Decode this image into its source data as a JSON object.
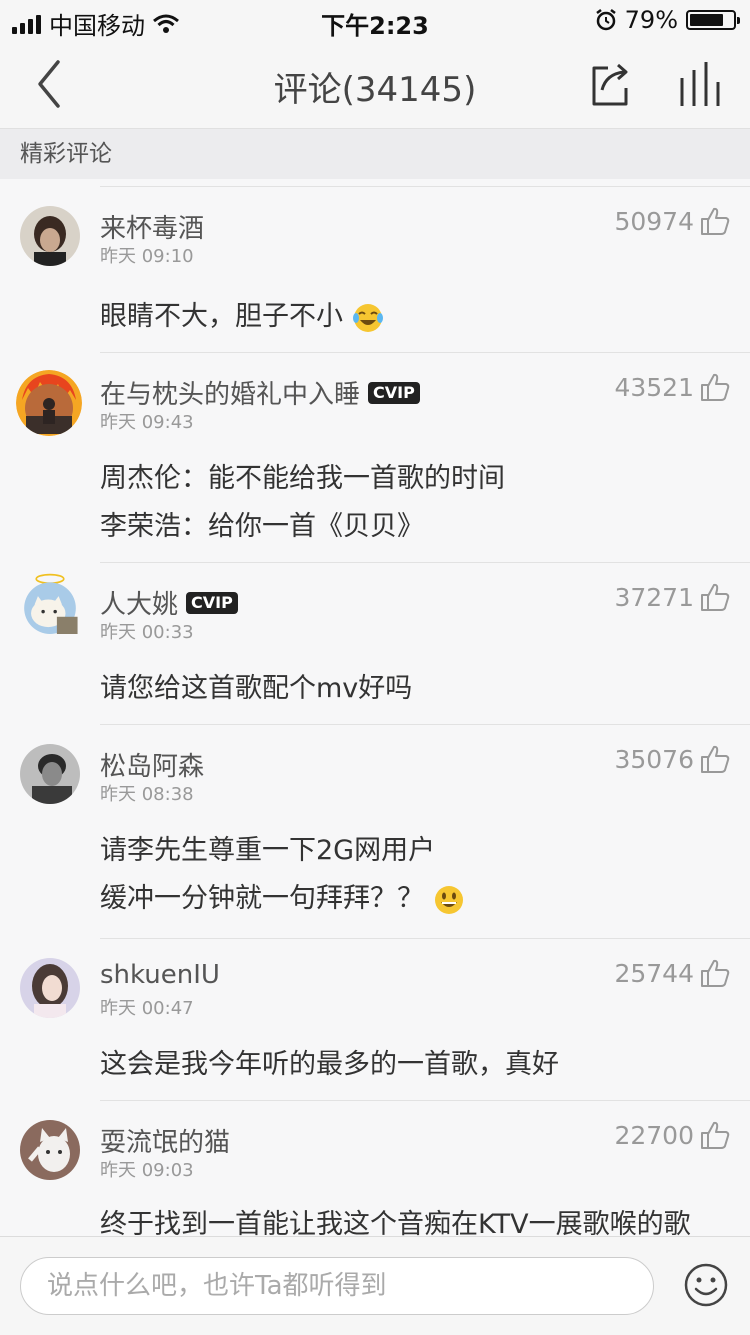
{
  "status": {
    "carrier": "中国移动",
    "time": "下午2:23",
    "battery": "79%"
  },
  "header": {
    "title": "评论(34145)"
  },
  "section": {
    "title": "精彩评论"
  },
  "comments": [
    {
      "user": "来杯毒酒",
      "time": "昨天 09:10",
      "likes": "50974",
      "lines": [
        "眼睛不大，胆子不小"
      ],
      "emoji": "tears-of-joy",
      "vip": ""
    },
    {
      "user": "在与枕头的婚礼中入睡",
      "time": "昨天 09:43",
      "likes": "43521",
      "lines": [
        "周杰伦：能不能给我一首歌的时间",
        "李荣浩：给你一首《贝贝》"
      ],
      "vip": "CVIP"
    },
    {
      "user": "人大姚",
      "time": "昨天 00:33",
      "likes": "37271",
      "lines": [
        "请您给这首歌配个mv好吗"
      ],
      "vip": "CVIP"
    },
    {
      "user": "松岛阿森",
      "time": "昨天 08:38",
      "likes": "35076",
      "lines": [
        "请李先生尊重一下2G网用户",
        "缓冲一分钟就一句拜拜？？"
      ],
      "emoji": "grinning",
      "vip": ""
    },
    {
      "user": "shkuenIU",
      "time": "昨天 00:47",
      "likes": "25744",
      "lines": [
        "这会是我今年听的最多的一首歌，真好"
      ],
      "vip": ""
    },
    {
      "user": "耍流氓的猫",
      "time": "昨天 09:03",
      "likes": "22700",
      "lines": [
        "终于找到一首能让我这个音痴在KTV一展歌喉的歌"
      ],
      "vip": ""
    }
  ],
  "composer": {
    "placeholder": "说点什么吧，也许Ta都听得到"
  },
  "icons": {
    "back": "chevron-left-icon",
    "share": "share-icon",
    "bars": "equalizer-icon",
    "like": "thumbs-up-icon",
    "smile": "smile-icon"
  }
}
